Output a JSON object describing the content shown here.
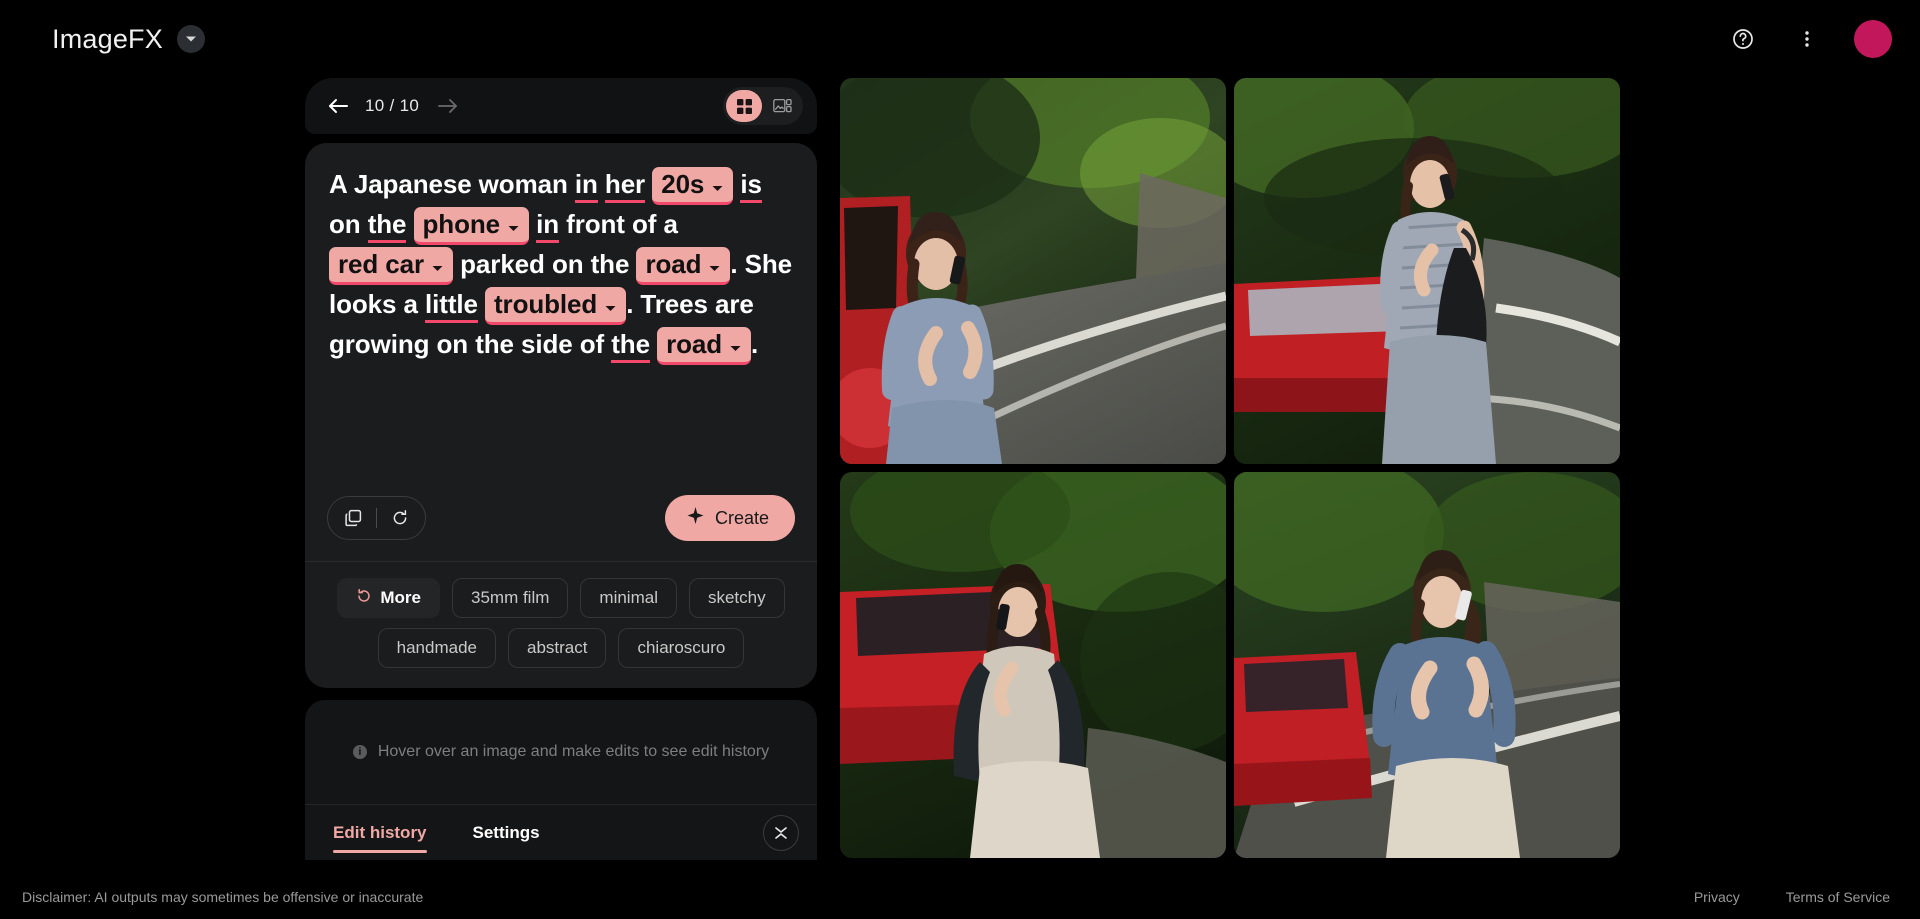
{
  "header": {
    "brand_title": "ImageFX",
    "brand_chevron_icon": "chevron-down-icon",
    "help_icon": "help-circle-icon",
    "more_icon": "more-vertical-icon",
    "avatar_icon": "avatar",
    "avatar_color": "#c2185b"
  },
  "nav": {
    "back_icon": "arrow-left-icon",
    "forward_icon": "arrow-right-icon",
    "counter": "10 / 10",
    "view_grid_icon": "grid-view-icon",
    "view_detail_icon": "detail-view-icon",
    "active_view": "grid"
  },
  "prompt": {
    "segments": [
      {
        "type": "text",
        "value": "A Japanese woman "
      },
      {
        "type": "underline",
        "value": "in"
      },
      {
        "type": "text",
        "value": " "
      },
      {
        "type": "underline",
        "value": "her"
      },
      {
        "type": "text",
        "value": " "
      },
      {
        "type": "chip",
        "value": "20s"
      },
      {
        "type": "text",
        "value": " "
      },
      {
        "type": "underline",
        "value": "is"
      },
      {
        "type": "text",
        "value": " on "
      },
      {
        "type": "underline",
        "value": "the"
      },
      {
        "type": "text",
        "value": " "
      },
      {
        "type": "chip",
        "value": "phone"
      },
      {
        "type": "text",
        "value": " "
      },
      {
        "type": "underline",
        "value": "in"
      },
      {
        "type": "text",
        "value": " front of a "
      },
      {
        "type": "chip",
        "value": "red car"
      },
      {
        "type": "text",
        "value": " parked on the "
      },
      {
        "type": "chip",
        "value": "road"
      },
      {
        "type": "text",
        "value": ". She looks a "
      },
      {
        "type": "underline",
        "value": "little"
      },
      {
        "type": "text",
        "value": " "
      },
      {
        "type": "chip",
        "value": "troubled"
      },
      {
        "type": "text",
        "value": ". Trees are growing on the side of "
      },
      {
        "type": "underline",
        "value": "the"
      },
      {
        "type": "text",
        "value": " "
      },
      {
        "type": "chip",
        "value": "road"
      },
      {
        "type": "text",
        "value": "."
      }
    ],
    "plain_text": "A Japanese woman in her 20s is on the phone in front of a red car parked on the road. She looks a little troubled. Trees are growing on the side of the road.",
    "chip_bg": "#efa8a4",
    "underline_color": "#f2496b",
    "copy_icon": "copy-icon",
    "reset_icon": "refresh-icon",
    "create_label": "Create",
    "create_icon": "sparkle-icon"
  },
  "style_chips": [
    {
      "label": "More",
      "icon": "refresh-icon",
      "filled": true
    },
    {
      "label": "35mm film",
      "icon": "",
      "filled": false
    },
    {
      "label": "minimal",
      "icon": "",
      "filled": false
    },
    {
      "label": "sketchy",
      "icon": "",
      "filled": false
    },
    {
      "label": "handmade",
      "icon": "",
      "filled": false
    },
    {
      "label": "abstract",
      "icon": "",
      "filled": false
    },
    {
      "label": "chiaroscuro",
      "icon": "",
      "filled": false
    }
  ],
  "history": {
    "empty_message": "Hover over an image and make edits to see edit history",
    "info_icon": "info-icon",
    "tabs": [
      {
        "label": "Edit history",
        "active": true
      },
      {
        "label": "Settings",
        "active": false
      }
    ],
    "collapse_icon": "collapse-expand-icon"
  },
  "images": [
    {
      "alt": "Japanese woman in blue dress on phone beside red car on forest road"
    },
    {
      "alt": "Japanese woman in striped dress with black bag on phone by red car"
    },
    {
      "alt": "Japanese woman in dark jacket on phone in front of red car"
    },
    {
      "alt": "Japanese woman in blue sweater on phone near red car on road"
    }
  ],
  "footer": {
    "disclaimer": "Disclaimer: AI outputs may sometimes be offensive or inaccurate",
    "links": [
      "Privacy",
      "Terms of Service"
    ]
  }
}
